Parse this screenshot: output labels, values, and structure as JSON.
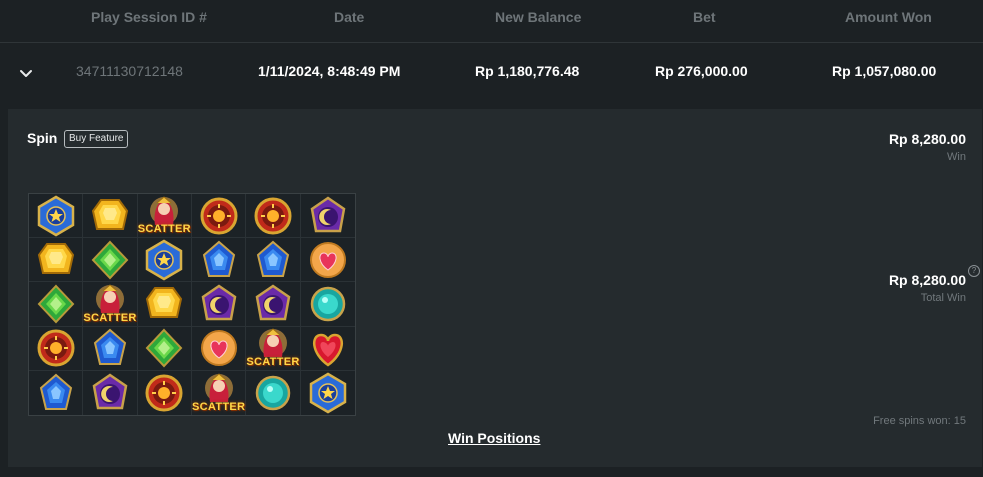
{
  "columns": [
    "Play Session ID #",
    "Date",
    "New Balance",
    "Bet",
    "Amount Won"
  ],
  "session": {
    "id": "34711130712148",
    "date": "1/11/2024, 8:48:49 PM",
    "new_balance": "Rp 1,180,776.48",
    "bet": "Rp 276,000.00",
    "amount_won": "Rp 1,057,080.00"
  },
  "spin": {
    "title": "Spin",
    "badge": "Buy Feature",
    "win_amount": "Rp 8,280.00",
    "win_label": "Win",
    "total_win_amount": "Rp 8,280.00",
    "total_win_label": "Total Win",
    "help_glyph": "?",
    "free_spins_text": "Free spins won: 15",
    "win_positions_label": "Win Positions",
    "scatter_text": "SCATTER"
  },
  "grid": [
    [
      "blue-star-gem",
      "yellow-gem",
      "scatter",
      "red-sun-gem",
      "red-sun-gem",
      "purple-moon-gem"
    ],
    [
      "yellow-gem",
      "green-gem",
      "blue-star-gem",
      "blue-gem",
      "blue-gem",
      "heart-gem"
    ],
    [
      "green-gem",
      "scatter",
      "yellow-gem",
      "purple-moon-gem",
      "purple-moon-gem",
      "teal-gem"
    ],
    [
      "red-sun-gem",
      "blue-gem",
      "green-gem",
      "heart-gem",
      "scatter",
      "red-heart-gem"
    ],
    [
      "blue-gem",
      "purple-moon-gem",
      "red-sun-gem",
      "scatter",
      "teal-gem",
      "blue-star-gem"
    ]
  ]
}
